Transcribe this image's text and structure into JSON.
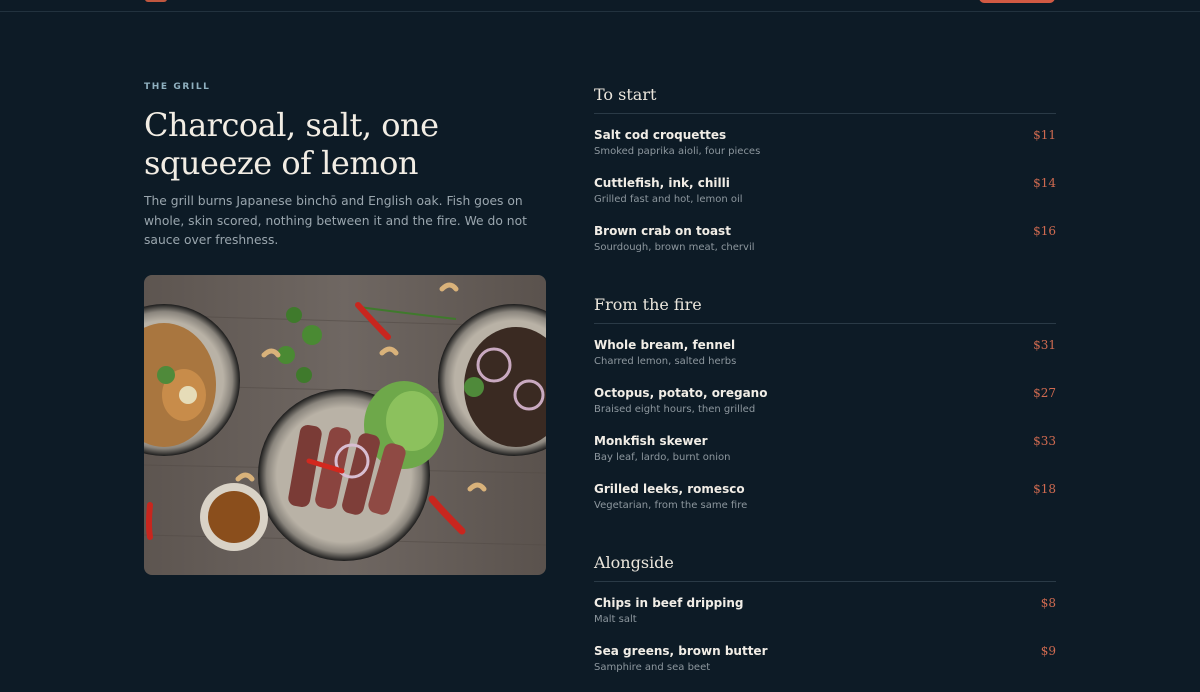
{
  "colors": {
    "background": "#0d1b26",
    "accent": "#d25a43",
    "price": "#cf6a50",
    "eyebrow": "#8fb0bf"
  },
  "intro": {
    "eyebrow": "THE GRILL",
    "headline": "Charcoal, salt, one squeeze of lemon",
    "body": "The grill burns Japanese binchō and English oak. Fish goes on whole, skin scored, nothing between it and the fire. We do not sauce over freshness."
  },
  "menu": {
    "sections": [
      {
        "title": "To start",
        "items": [
          {
            "name": "Salt cod croquettes",
            "desc": "Smoked paprika aioli, four pieces",
            "price": "$11"
          },
          {
            "name": "Cuttlefish, ink, chilli",
            "desc": "Grilled fast and hot, lemon oil",
            "price": "$14"
          },
          {
            "name": "Brown crab on toast",
            "desc": "Sourdough, brown meat, chervil",
            "price": "$16"
          }
        ]
      },
      {
        "title": "From the fire",
        "items": [
          {
            "name": "Whole bream, fennel",
            "desc": "Charred lemon, salted herbs",
            "price": "$31"
          },
          {
            "name": "Octopus, potato, oregano",
            "desc": "Braised eight hours, then grilled",
            "price": "$27"
          },
          {
            "name": "Monkfish skewer",
            "desc": "Bay leaf, lardo, burnt onion",
            "price": "$33"
          },
          {
            "name": "Grilled leeks, romesco",
            "desc": "Vegetarian, from the same fire",
            "price": "$18"
          }
        ]
      },
      {
        "title": "Alongside",
        "items": [
          {
            "name": "Chips in beef dripping",
            "desc": "Malt salt",
            "price": "$8"
          },
          {
            "name": "Sea greens, brown butter",
            "desc": "Samphire and sea beet",
            "price": "$9"
          }
        ]
      }
    ]
  }
}
